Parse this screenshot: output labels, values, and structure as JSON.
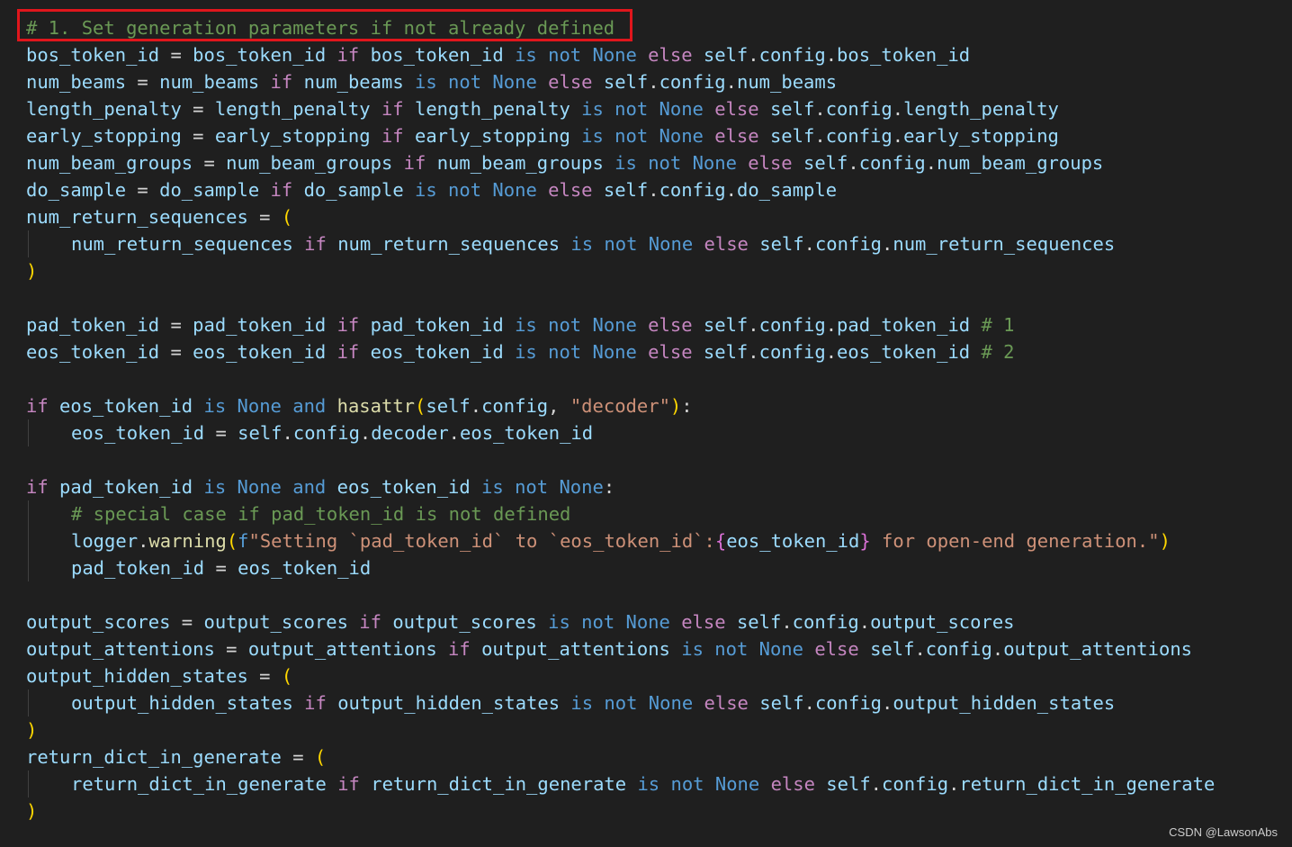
{
  "watermark": "CSDN @LawsonAbs",
  "annotation": {
    "highlighted_text": "# 1. Set generation parameters if not already defined",
    "box_color": "#e0161c"
  },
  "colors": {
    "background": "#1f1f1f",
    "variable": "#9cdcfe",
    "keyword": "#c586c0",
    "constant": "#569cd6",
    "comment": "#6a9955",
    "function": "#dcdcaa",
    "string": "#ce9178",
    "bracket": "#ffd700"
  },
  "code_lines": [
    {
      "indent": false,
      "tokens": [
        {
          "c": "cmt",
          "t": "# 1. Set generation parameters if not already defined"
        }
      ]
    },
    {
      "indent": false,
      "tokens": [
        {
          "c": "var",
          "t": "bos_token_id"
        },
        {
          "c": "op",
          "t": " = "
        },
        {
          "c": "var",
          "t": "bos_token_id"
        },
        {
          "c": "kw",
          "t": " if "
        },
        {
          "c": "var",
          "t": "bos_token_id"
        },
        {
          "c": "none",
          "t": " is not None"
        },
        {
          "c": "kw",
          "t": " else "
        },
        {
          "c": "self",
          "t": "self"
        },
        {
          "c": "pun",
          "t": "."
        },
        {
          "c": "attr",
          "t": "config"
        },
        {
          "c": "pun",
          "t": "."
        },
        {
          "c": "attr",
          "t": "bos_token_id"
        }
      ]
    },
    {
      "indent": false,
      "tokens": [
        {
          "c": "var",
          "t": "num_beams"
        },
        {
          "c": "op",
          "t": " = "
        },
        {
          "c": "var",
          "t": "num_beams"
        },
        {
          "c": "kw",
          "t": " if "
        },
        {
          "c": "var",
          "t": "num_beams"
        },
        {
          "c": "none",
          "t": " is not None"
        },
        {
          "c": "kw",
          "t": " else "
        },
        {
          "c": "self",
          "t": "self"
        },
        {
          "c": "pun",
          "t": "."
        },
        {
          "c": "attr",
          "t": "config"
        },
        {
          "c": "pun",
          "t": "."
        },
        {
          "c": "attr",
          "t": "num_beams"
        }
      ]
    },
    {
      "indent": false,
      "tokens": [
        {
          "c": "var",
          "t": "length_penalty"
        },
        {
          "c": "op",
          "t": " = "
        },
        {
          "c": "var",
          "t": "length_penalty"
        },
        {
          "c": "kw",
          "t": " if "
        },
        {
          "c": "var",
          "t": "length_penalty"
        },
        {
          "c": "none",
          "t": " is not None"
        },
        {
          "c": "kw",
          "t": " else "
        },
        {
          "c": "self",
          "t": "self"
        },
        {
          "c": "pun",
          "t": "."
        },
        {
          "c": "attr",
          "t": "config"
        },
        {
          "c": "pun",
          "t": "."
        },
        {
          "c": "attr",
          "t": "length_penalty"
        }
      ]
    },
    {
      "indent": false,
      "tokens": [
        {
          "c": "var",
          "t": "early_stopping"
        },
        {
          "c": "op",
          "t": " = "
        },
        {
          "c": "var",
          "t": "early_stopping"
        },
        {
          "c": "kw",
          "t": " if "
        },
        {
          "c": "var",
          "t": "early_stopping"
        },
        {
          "c": "none",
          "t": " is not None"
        },
        {
          "c": "kw",
          "t": " else "
        },
        {
          "c": "self",
          "t": "self"
        },
        {
          "c": "pun",
          "t": "."
        },
        {
          "c": "attr",
          "t": "config"
        },
        {
          "c": "pun",
          "t": "."
        },
        {
          "c": "attr",
          "t": "early_stopping"
        }
      ]
    },
    {
      "indent": false,
      "tokens": [
        {
          "c": "var",
          "t": "num_beam_groups"
        },
        {
          "c": "op",
          "t": " = "
        },
        {
          "c": "var",
          "t": "num_beam_groups"
        },
        {
          "c": "kw",
          "t": " if "
        },
        {
          "c": "var",
          "t": "num_beam_groups"
        },
        {
          "c": "none",
          "t": " is not None"
        },
        {
          "c": "kw",
          "t": " else "
        },
        {
          "c": "self",
          "t": "self"
        },
        {
          "c": "pun",
          "t": "."
        },
        {
          "c": "attr",
          "t": "config"
        },
        {
          "c": "pun",
          "t": "."
        },
        {
          "c": "attr",
          "t": "num_beam_groups"
        }
      ]
    },
    {
      "indent": false,
      "tokens": [
        {
          "c": "var",
          "t": "do_sample"
        },
        {
          "c": "op",
          "t": " = "
        },
        {
          "c": "var",
          "t": "do_sample"
        },
        {
          "c": "kw",
          "t": " if "
        },
        {
          "c": "var",
          "t": "do_sample"
        },
        {
          "c": "none",
          "t": " is not None"
        },
        {
          "c": "kw",
          "t": " else "
        },
        {
          "c": "self",
          "t": "self"
        },
        {
          "c": "pun",
          "t": "."
        },
        {
          "c": "attr",
          "t": "config"
        },
        {
          "c": "pun",
          "t": "."
        },
        {
          "c": "attr",
          "t": "do_sample"
        }
      ]
    },
    {
      "indent": false,
      "tokens": [
        {
          "c": "var",
          "t": "num_return_sequences"
        },
        {
          "c": "op",
          "t": " = "
        },
        {
          "c": "paren",
          "t": "("
        }
      ]
    },
    {
      "indent": true,
      "tokens": [
        {
          "c": "var",
          "t": "num_return_sequences"
        },
        {
          "c": "kw",
          "t": " if "
        },
        {
          "c": "var",
          "t": "num_return_sequences"
        },
        {
          "c": "none",
          "t": " is not None"
        },
        {
          "c": "kw",
          "t": " else "
        },
        {
          "c": "self",
          "t": "self"
        },
        {
          "c": "pun",
          "t": "."
        },
        {
          "c": "attr",
          "t": "config"
        },
        {
          "c": "pun",
          "t": "."
        },
        {
          "c": "attr",
          "t": "num_return_sequences"
        }
      ]
    },
    {
      "indent": false,
      "tokens": [
        {
          "c": "paren",
          "t": ")"
        }
      ]
    },
    {
      "indent": false,
      "tokens": []
    },
    {
      "indent": false,
      "tokens": [
        {
          "c": "var",
          "t": "pad_token_id"
        },
        {
          "c": "op",
          "t": " = "
        },
        {
          "c": "var",
          "t": "pad_token_id"
        },
        {
          "c": "kw",
          "t": " if "
        },
        {
          "c": "var",
          "t": "pad_token_id"
        },
        {
          "c": "none",
          "t": " is not None"
        },
        {
          "c": "kw",
          "t": " else "
        },
        {
          "c": "self",
          "t": "self"
        },
        {
          "c": "pun",
          "t": "."
        },
        {
          "c": "attr",
          "t": "config"
        },
        {
          "c": "pun",
          "t": "."
        },
        {
          "c": "attr",
          "t": "pad_token_id"
        },
        {
          "c": "cmt",
          "t": " # 1"
        }
      ]
    },
    {
      "indent": false,
      "tokens": [
        {
          "c": "var",
          "t": "eos_token_id"
        },
        {
          "c": "op",
          "t": " = "
        },
        {
          "c": "var",
          "t": "eos_token_id"
        },
        {
          "c": "kw",
          "t": " if "
        },
        {
          "c": "var",
          "t": "eos_token_id"
        },
        {
          "c": "none",
          "t": " is not None"
        },
        {
          "c": "kw",
          "t": " else "
        },
        {
          "c": "self",
          "t": "self"
        },
        {
          "c": "pun",
          "t": "."
        },
        {
          "c": "attr",
          "t": "config"
        },
        {
          "c": "pun",
          "t": "."
        },
        {
          "c": "attr",
          "t": "eos_token_id"
        },
        {
          "c": "cmt",
          "t": " # 2"
        }
      ]
    },
    {
      "indent": false,
      "tokens": []
    },
    {
      "indent": false,
      "tokens": [
        {
          "c": "kw",
          "t": "if "
        },
        {
          "c": "var",
          "t": "eos_token_id"
        },
        {
          "c": "none",
          "t": " is None"
        },
        {
          "c": "none",
          "t": " and "
        },
        {
          "c": "fn",
          "t": "hasattr"
        },
        {
          "c": "paren",
          "t": "("
        },
        {
          "c": "self",
          "t": "self"
        },
        {
          "c": "pun",
          "t": "."
        },
        {
          "c": "attr",
          "t": "config"
        },
        {
          "c": "pun",
          "t": ", "
        },
        {
          "c": "str",
          "t": "\"decoder\""
        },
        {
          "c": "paren",
          "t": ")"
        },
        {
          "c": "pun",
          "t": ":"
        }
      ]
    },
    {
      "indent": true,
      "tokens": [
        {
          "c": "var",
          "t": "eos_token_id"
        },
        {
          "c": "op",
          "t": " = "
        },
        {
          "c": "self",
          "t": "self"
        },
        {
          "c": "pun",
          "t": "."
        },
        {
          "c": "attr",
          "t": "config"
        },
        {
          "c": "pun",
          "t": "."
        },
        {
          "c": "attr",
          "t": "decoder"
        },
        {
          "c": "pun",
          "t": "."
        },
        {
          "c": "attr",
          "t": "eos_token_id"
        }
      ]
    },
    {
      "indent": false,
      "tokens": []
    },
    {
      "indent": false,
      "tokens": [
        {
          "c": "kw",
          "t": "if "
        },
        {
          "c": "var",
          "t": "pad_token_id"
        },
        {
          "c": "none",
          "t": " is None"
        },
        {
          "c": "none",
          "t": " and "
        },
        {
          "c": "var",
          "t": "eos_token_id"
        },
        {
          "c": "none",
          "t": " is not None"
        },
        {
          "c": "pun",
          "t": ":"
        }
      ]
    },
    {
      "indent": true,
      "tokens": [
        {
          "c": "cmt",
          "t": "# special case if pad_token_id is not defined"
        }
      ]
    },
    {
      "indent": true,
      "tokens": [
        {
          "c": "var",
          "t": "logger"
        },
        {
          "c": "pun",
          "t": "."
        },
        {
          "c": "fn",
          "t": "warning"
        },
        {
          "c": "paren",
          "t": "("
        },
        {
          "c": "fprefix",
          "t": "f"
        },
        {
          "c": "str",
          "t": "\"Setting `pad_token_id` to `eos_token_id`:"
        },
        {
          "c": "brace",
          "t": "{"
        },
        {
          "c": "var",
          "t": "eos_token_id"
        },
        {
          "c": "brace",
          "t": "}"
        },
        {
          "c": "str",
          "t": " for open-end generation.\""
        },
        {
          "c": "paren",
          "t": ")"
        }
      ]
    },
    {
      "indent": true,
      "tokens": [
        {
          "c": "var",
          "t": "pad_token_id"
        },
        {
          "c": "op",
          "t": " = "
        },
        {
          "c": "var",
          "t": "eos_token_id"
        }
      ]
    },
    {
      "indent": false,
      "tokens": []
    },
    {
      "indent": false,
      "tokens": [
        {
          "c": "var",
          "t": "output_scores"
        },
        {
          "c": "op",
          "t": " = "
        },
        {
          "c": "var",
          "t": "output_scores"
        },
        {
          "c": "kw",
          "t": " if "
        },
        {
          "c": "var",
          "t": "output_scores"
        },
        {
          "c": "none",
          "t": " is not None"
        },
        {
          "c": "kw",
          "t": " else "
        },
        {
          "c": "self",
          "t": "self"
        },
        {
          "c": "pun",
          "t": "."
        },
        {
          "c": "attr",
          "t": "config"
        },
        {
          "c": "pun",
          "t": "."
        },
        {
          "c": "attr",
          "t": "output_scores"
        }
      ]
    },
    {
      "indent": false,
      "tokens": [
        {
          "c": "var",
          "t": "output_attentions"
        },
        {
          "c": "op",
          "t": " = "
        },
        {
          "c": "var",
          "t": "output_attentions"
        },
        {
          "c": "kw",
          "t": " if "
        },
        {
          "c": "var",
          "t": "output_attentions"
        },
        {
          "c": "none",
          "t": " is not None"
        },
        {
          "c": "kw",
          "t": " else "
        },
        {
          "c": "self",
          "t": "self"
        },
        {
          "c": "pun",
          "t": "."
        },
        {
          "c": "attr",
          "t": "config"
        },
        {
          "c": "pun",
          "t": "."
        },
        {
          "c": "attr",
          "t": "output_attentions"
        }
      ]
    },
    {
      "indent": false,
      "tokens": [
        {
          "c": "var",
          "t": "output_hidden_states"
        },
        {
          "c": "op",
          "t": " = "
        },
        {
          "c": "paren",
          "t": "("
        }
      ]
    },
    {
      "indent": true,
      "tokens": [
        {
          "c": "var",
          "t": "output_hidden_states"
        },
        {
          "c": "kw",
          "t": " if "
        },
        {
          "c": "var",
          "t": "output_hidden_states"
        },
        {
          "c": "none",
          "t": " is not None"
        },
        {
          "c": "kw",
          "t": " else "
        },
        {
          "c": "self",
          "t": "self"
        },
        {
          "c": "pun",
          "t": "."
        },
        {
          "c": "attr",
          "t": "config"
        },
        {
          "c": "pun",
          "t": "."
        },
        {
          "c": "attr",
          "t": "output_hidden_states"
        }
      ]
    },
    {
      "indent": false,
      "tokens": [
        {
          "c": "paren",
          "t": ")"
        }
      ]
    },
    {
      "indent": false,
      "tokens": [
        {
          "c": "var",
          "t": "return_dict_in_generate"
        },
        {
          "c": "op",
          "t": " = "
        },
        {
          "c": "paren",
          "t": "("
        }
      ]
    },
    {
      "indent": true,
      "tokens": [
        {
          "c": "var",
          "t": "return_dict_in_generate"
        },
        {
          "c": "kw",
          "t": " if "
        },
        {
          "c": "var",
          "t": "return_dict_in_generate"
        },
        {
          "c": "none",
          "t": " is not None"
        },
        {
          "c": "kw",
          "t": " else "
        },
        {
          "c": "self",
          "t": "self"
        },
        {
          "c": "pun",
          "t": "."
        },
        {
          "c": "attr",
          "t": "config"
        },
        {
          "c": "pun",
          "t": "."
        },
        {
          "c": "attr",
          "t": "return_dict_in_generate"
        }
      ]
    },
    {
      "indent": false,
      "tokens": [
        {
          "c": "paren",
          "t": ")"
        }
      ]
    }
  ]
}
